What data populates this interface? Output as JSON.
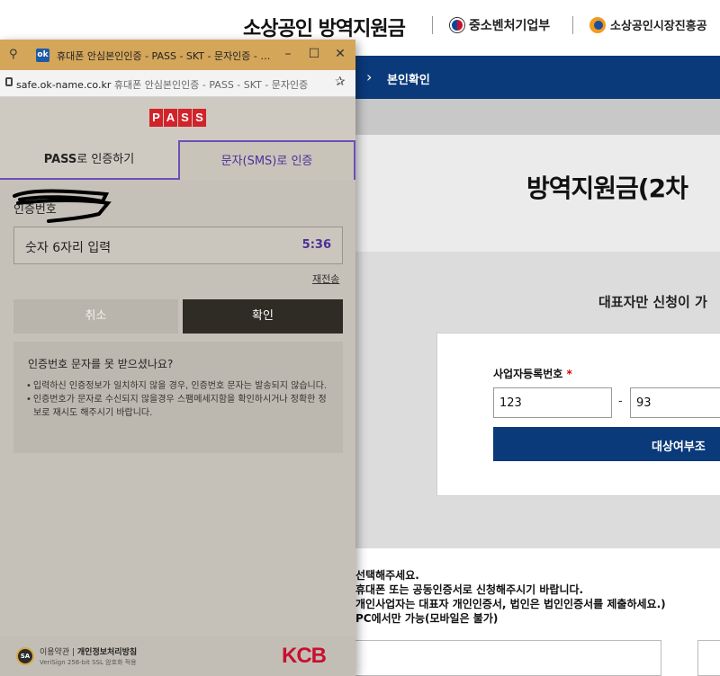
{
  "site": {
    "title": "소상공인 방역지원금",
    "ministry": "중소벤처기업부",
    "agency": "소상공인시장진흥공",
    "nav_label": "본인확인",
    "hero_title": "방역지원금(2차",
    "rep_note": "대표자만 신청이 가",
    "form": {
      "biz_label": "사업자등록번호",
      "required_mark": "*",
      "field1_value": "123",
      "dash": "-",
      "field2_value": "93",
      "check_button": "대상여부조"
    },
    "notes": [
      "선택해주세요.",
      "휴대폰 또는 공동인증서로 신청해주시기 바랍니다.",
      "개인사업자는 대표자 개인인증서, 법인은 법인인증서를 제출하세요.)",
      "PC에서만 가능(모바일은 불가)"
    ]
  },
  "popup": {
    "window_title": "휴대폰 안심본인인증 - PASS - SKT - 문자인증 - 인증...",
    "url_host": "safe.ok-name.co.kr",
    "url_rest": " 휴대폰 안심본인인증 - PASS - SKT - 문자인증",
    "ok_badge": "ok",
    "pass_letters": [
      "P",
      "A",
      "S",
      "S"
    ],
    "tabs": {
      "pass_bold": "PASS",
      "pass_rest": "로 인증하기",
      "sms": "문자(SMS)로 인증"
    },
    "auth_label": "인증번호",
    "code_placeholder": "숫자 6자리 입력",
    "timer": "5:36",
    "resend": "재전송",
    "cancel": "취소",
    "confirm": "확인",
    "help_title": "인증번호 문자를 못 받으셨나요?",
    "help_items": [
      "입력하신 인증정보가 일치하지 않을 경우, 인증번호 문자는 발송되지 않습니다.",
      "인증번호가 문자로 수신되지 않을경우 스팸메세지함을 확인하시거나 정확한 정보로 재시도 해주시기 바랍니다."
    ],
    "footer": {
      "terms": "이용약관",
      "privacy": "개인정보처리방침",
      "sub": "VeriSign 256-bit SSL 암호화 적용",
      "seal": "SA",
      "brand": "KCB"
    }
  }
}
